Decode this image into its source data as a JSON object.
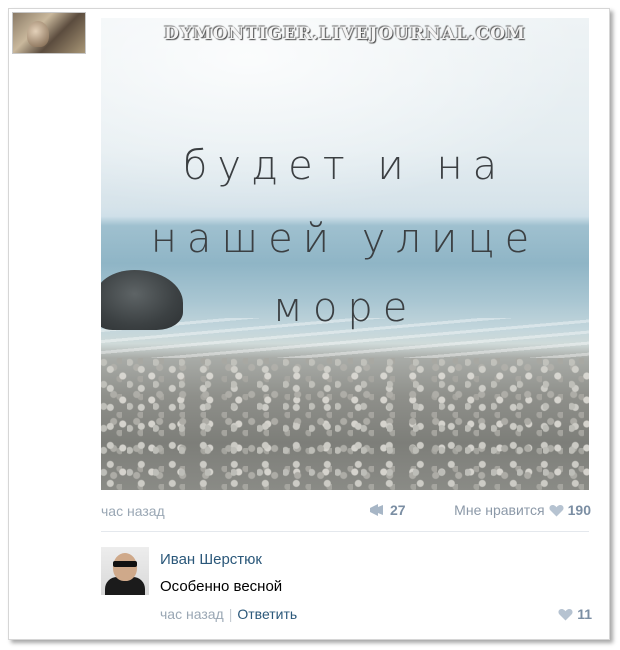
{
  "watermark": "DYMONTIGER.LIVEJOURNAL.COM",
  "post": {
    "image_text": {
      "line1": "будет и на",
      "line2": "нашей улице",
      "line3": "море"
    },
    "time": "час назад",
    "reposts": "27",
    "like_label": "Мне нравится",
    "likes": "190"
  },
  "comment": {
    "author": "Иван Шерстюк",
    "text": "Особенно весной",
    "time": "час назад",
    "separator": "|",
    "reply_label": "Ответить",
    "likes": "11"
  },
  "icons": {
    "repost": "megaphone-icon",
    "like": "heart-icon"
  },
  "colors": {
    "link": "#2b587a",
    "meta": "#9aa7b4",
    "counter": "#7b8ea3"
  }
}
